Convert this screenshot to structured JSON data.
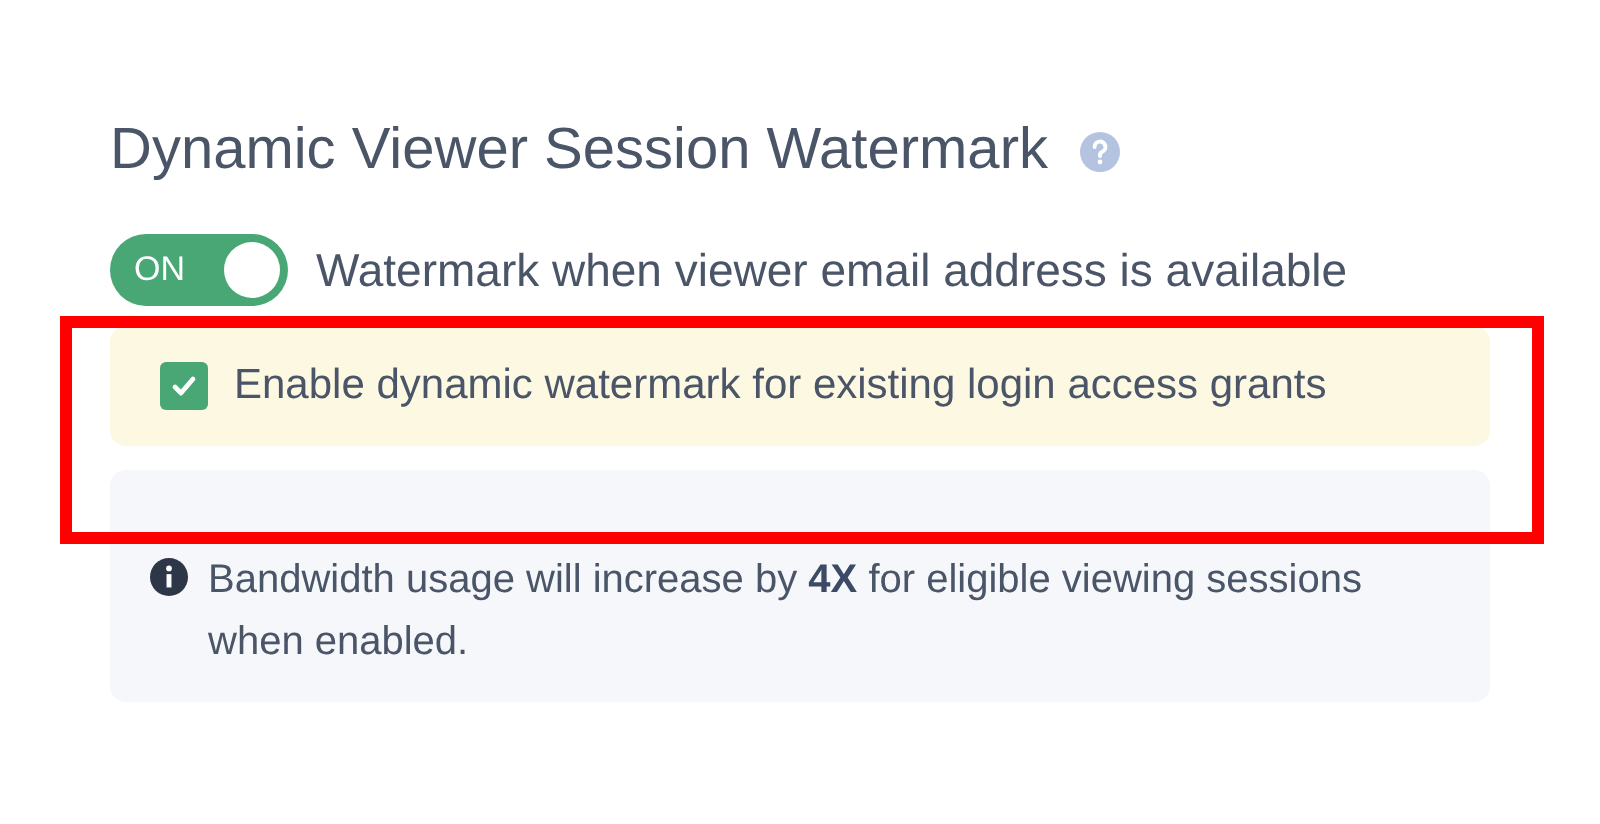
{
  "title": "Dynamic Viewer Session Watermark",
  "toggle": {
    "label": "ON",
    "on": true,
    "text": "Watermark when viewer email address is available"
  },
  "option": {
    "label": "Enable dynamic watermark for existing login access grants",
    "checked": true,
    "highlighted": true
  },
  "note": {
    "text": "Bandwidth usage will increase by **4X** for eligible viewing sessions when enabled."
  }
}
